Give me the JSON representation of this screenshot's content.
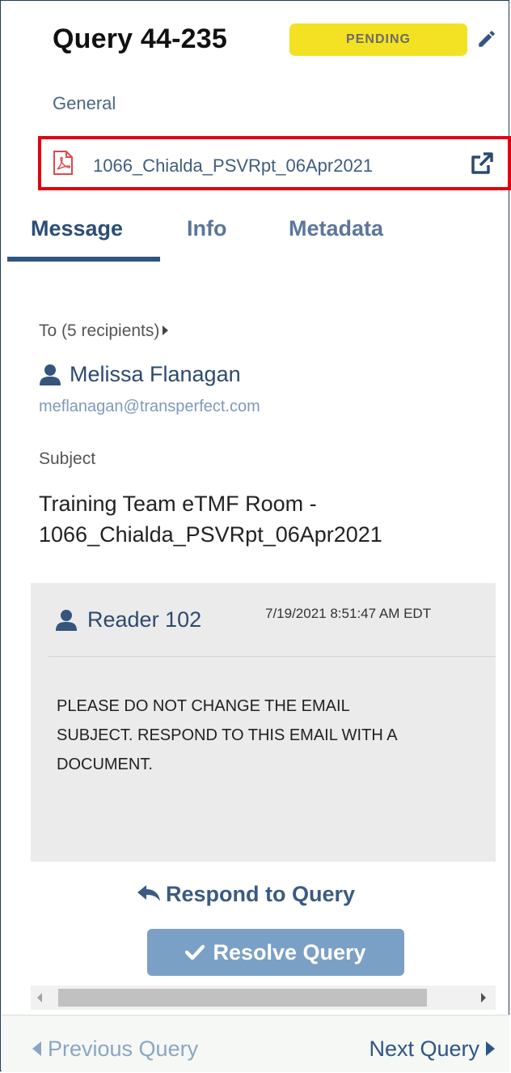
{
  "header": {
    "title": "Query 44-235",
    "status": "PENDING"
  },
  "category": "General",
  "document": {
    "file_name": "1066_Chialda_PSVRpt_06Apr2021"
  },
  "tabs": [
    {
      "label": "Message",
      "active": true
    },
    {
      "label": "Info",
      "active": false
    },
    {
      "label": "Metadata",
      "active": false
    }
  ],
  "message": {
    "to_label": "To (5 recipients)",
    "recipient_name": "Melissa Flanagan",
    "recipient_email": "meflanagan@transperfect.com",
    "subject_label": "Subject",
    "subject_line1": "Training Team eTMF Room -",
    "subject_line2": "1066_Chialda_PSVRpt_06Apr2021",
    "author": "Reader 102",
    "timestamp": "7/19/2021 8:51:47 AM EDT",
    "body_line1": "PLEASE DO NOT CHANGE THE EMAIL",
    "body_line2": "SUBJECT. RESPOND TO THIS EMAIL WITH A",
    "body_line3": "DOCUMENT."
  },
  "actions": {
    "respond_label": "Respond to Query",
    "resolve_label": "Resolve Query"
  },
  "footer": {
    "prev_label": "Previous Query",
    "next_label": "Next Query"
  },
  "icons": {
    "edit": "pencil-icon",
    "file": "pdf-icon",
    "open": "external-link-icon",
    "user": "user-icon",
    "reply": "reply-icon",
    "check": "check-icon"
  },
  "colors": {
    "status_badge": "#f3e223",
    "highlight_border": "#e1000f",
    "primary": "#2f5583",
    "resolve_button": "#7aa0c5"
  }
}
